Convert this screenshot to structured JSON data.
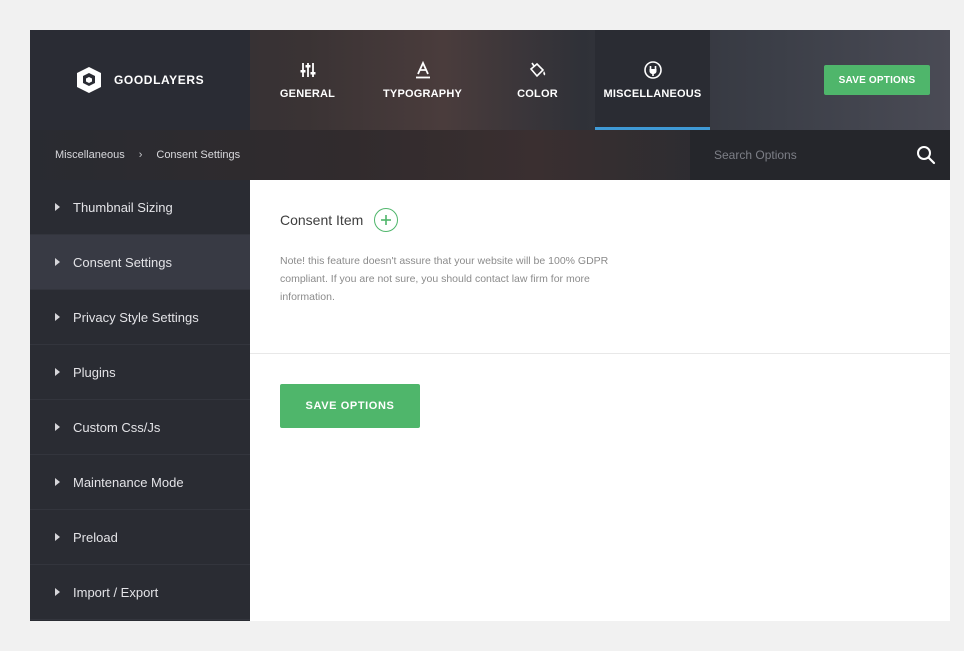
{
  "brand": {
    "name": "GOODLAYERS"
  },
  "nav": {
    "tabs": [
      {
        "label": "GENERAL",
        "icon": "sliders-icon"
      },
      {
        "label": "TYPOGRAPHY",
        "icon": "typography-icon"
      },
      {
        "label": "COLOR",
        "icon": "paint-bucket-icon"
      },
      {
        "label": "MISCELLANEOUS",
        "icon": "plug-icon",
        "active": true
      }
    ],
    "save_label": "SAVE OPTIONS"
  },
  "breadcrumb": {
    "parent": "Miscellaneous",
    "separator": "›",
    "current": "Consent Settings"
  },
  "search": {
    "placeholder": "Search Options",
    "value": ""
  },
  "sidebar": {
    "items": [
      {
        "label": "Thumbnail Sizing"
      },
      {
        "label": "Consent Settings",
        "active": true
      },
      {
        "label": "Privacy Style Settings"
      },
      {
        "label": "Plugins"
      },
      {
        "label": "Custom Css/Js"
      },
      {
        "label": "Maintenance Mode"
      },
      {
        "label": "Preload"
      },
      {
        "label": "Import / Export"
      }
    ]
  },
  "main": {
    "consent_title": "Consent Item",
    "note": "Note! this feature doesn't assure that your website will be 100% GDPR compliant. If you are not sure, you should contact law firm for more information.",
    "save_label": "SAVE OPTIONS"
  },
  "colors": {
    "accent_green": "#4fb66b",
    "active_tab_underline": "#3f9ad6",
    "sidebar_bg": "#2a2c33"
  }
}
